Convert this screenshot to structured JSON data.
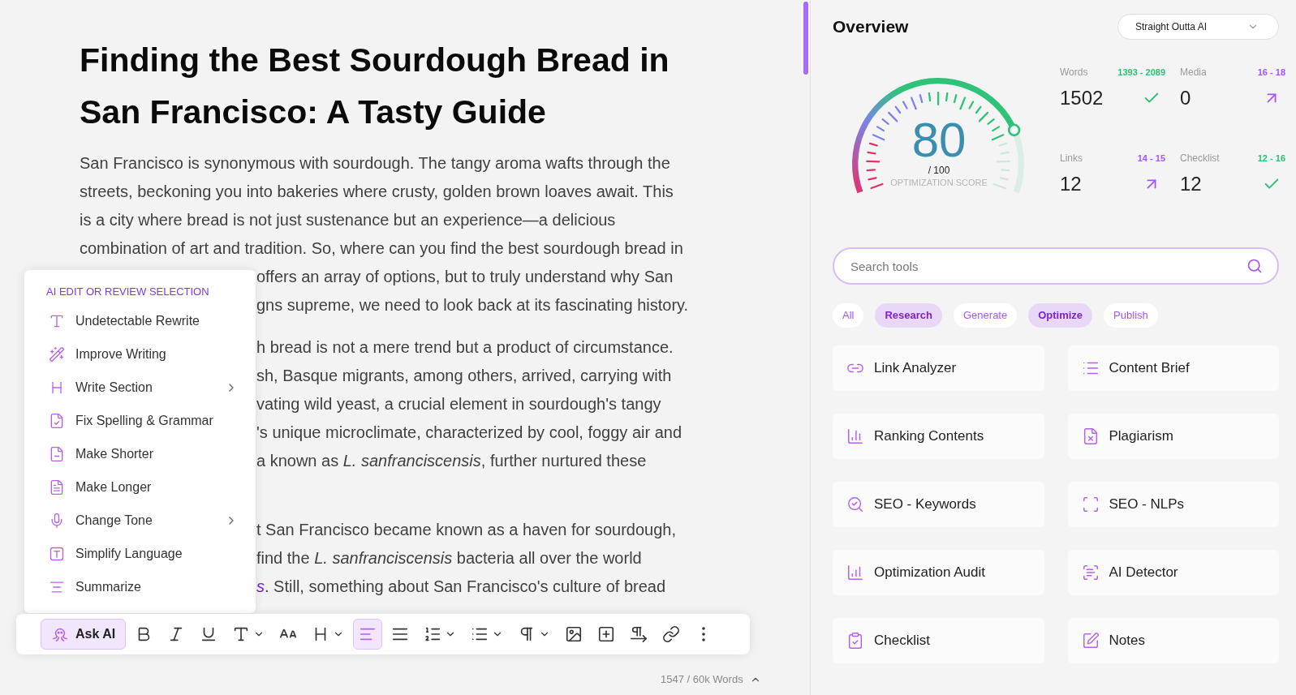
{
  "editor": {
    "title_lines": [
      "Finding the Best Sourdough Bread in",
      "San Francisco: A Tasty Guide"
    ],
    "paragraphs": [
      {
        "lines": [
          {
            "kind": "full",
            "text": "San Francisco is synonymous with sourdough. The tangy aroma wafts through the"
          },
          {
            "kind": "full",
            "text": "streets, beckoning you into bakeries where crusty, golden brown loaves await. This"
          },
          {
            "kind": "full",
            "text": "is a city where bread is not just sustenance but an experience—a delicious"
          },
          {
            "kind": "full",
            "text": "combination of art and tradition. So, where can you find the best sourdough bread in"
          },
          {
            "kind": "cut",
            "text": "offers an array of options, but to truly understand why San"
          },
          {
            "kind": "cut",
            "text": "gns supreme, we need to look back at its fascinating history."
          }
        ]
      },
      {
        "lines": [
          {
            "kind": "cut",
            "text": "h bread is not a mere trend but a product of circumstance."
          },
          {
            "kind": "cut",
            "text": "sh, Basque migrants, among others, arrived, carrying with"
          },
          {
            "kind": "cut",
            "text": "vating wild yeast, a crucial element in sourdough's tangy"
          },
          {
            "kind": "cut",
            "text": "'s unique microclimate, characterized by cool, foggy air and"
          },
          {
            "kind": "cut",
            "text": "a known as *L. sanfranciscensis*, further nurtured these"
          }
        ]
      },
      {
        "lines": [
          {
            "kind": "cut",
            "text": "t San Francisco became known as a haven for sourdough,"
          },
          {
            "kind": "cut",
            "text": "find the *L. sanfranciscensis* bacteria all over the world"
          },
          {
            "kind": "cut",
            "link": "s",
            "text": ". Still, something about San Francisco's culture of bread"
          }
        ]
      }
    ]
  },
  "ai_menu": {
    "heading": "AI EDIT OR REVIEW SELECTION",
    "items": [
      {
        "label": "Undetectable Rewrite",
        "has_submenu": false
      },
      {
        "label": "Improve Writing",
        "has_submenu": false
      },
      {
        "label": "Write Section",
        "has_submenu": true
      },
      {
        "label": "Fix Spelling & Grammar",
        "has_submenu": false
      },
      {
        "label": "Make Shorter",
        "has_submenu": false
      },
      {
        "label": "Make Longer",
        "has_submenu": false
      },
      {
        "label": "Change Tone",
        "has_submenu": true
      },
      {
        "label": "Simplify Language",
        "has_submenu": false
      },
      {
        "label": "Summarize",
        "has_submenu": false
      }
    ]
  },
  "toolbar": {
    "items": [
      {
        "kind": "ask",
        "label": "Ask AI",
        "selected": true
      },
      {
        "kind": "icon",
        "selected": false,
        "has_caret": false
      },
      {
        "kind": "icon",
        "selected": false,
        "has_caret": false
      },
      {
        "kind": "icon",
        "selected": false,
        "has_caret": false
      },
      {
        "kind": "icon",
        "selected": false,
        "has_caret": true
      },
      {
        "kind": "icon",
        "selected": false,
        "has_caret": false
      },
      {
        "kind": "icon",
        "selected": false,
        "has_caret": true
      },
      {
        "kind": "icon",
        "selected": true,
        "has_caret": false
      },
      {
        "kind": "icon",
        "selected": false,
        "has_caret": false
      },
      {
        "kind": "icon",
        "selected": false,
        "has_caret": true
      },
      {
        "kind": "icon",
        "selected": false,
        "has_caret": true
      },
      {
        "kind": "icon",
        "selected": false,
        "has_caret": true
      },
      {
        "kind": "icon",
        "selected": false,
        "has_caret": false
      },
      {
        "kind": "icon",
        "selected": false,
        "has_caret": false
      },
      {
        "kind": "icon",
        "selected": false,
        "has_caret": false
      },
      {
        "kind": "icon",
        "selected": false,
        "has_caret": false
      },
      {
        "kind": "icon",
        "selected": false,
        "has_caret": false
      }
    ]
  },
  "word_count": "1547 / 60k Words",
  "overview": {
    "title": "Overview",
    "preset": "Straight Outta AI",
    "gauge": {
      "score": "80",
      "out_of": "/ 100",
      "caption": "OPTIMIZATION SCORE"
    },
    "stats": [
      {
        "label": "Words",
        "range": "1393 - 2089",
        "value": "1502",
        "kind": "ok"
      },
      {
        "label": "Media",
        "range": "16 - 18",
        "value": "0",
        "kind": "up"
      },
      {
        "label": "Links",
        "range": "14 - 15",
        "value": "12",
        "kind": "up"
      },
      {
        "label": "Checklist",
        "range": "12 - 16",
        "value": "12",
        "kind": "ok"
      }
    ]
  },
  "tools": {
    "search": {
      "placeholder": "Search tools"
    },
    "filters": [
      {
        "label": "All",
        "selected": false
      },
      {
        "label": "Research",
        "selected": true
      },
      {
        "label": "Generate",
        "selected": false
      },
      {
        "label": "Optimize",
        "selected": true
      },
      {
        "label": "Publish",
        "selected": false
      }
    ],
    "items": [
      "Link Analyzer",
      "Content Brief",
      "Ranking Contents",
      "Plagiarism",
      "SEO - Keywords",
      "SEO - NLPs",
      "Optimization Audit",
      "AI Detector",
      "Checklist",
      "Notes"
    ]
  }
}
